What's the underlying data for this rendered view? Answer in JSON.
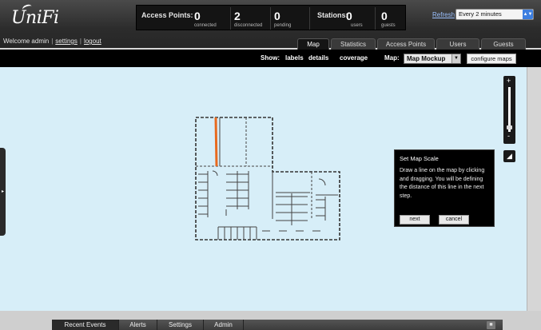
{
  "header": {
    "logo": "UniFi",
    "welcome_text": "Welcome admin",
    "settings_link": "settings",
    "logout_link": "logout"
  },
  "stats": {
    "access_points_label": "Access Points:",
    "stations_label": "Stations:",
    "items": [
      {
        "value": "0",
        "label": "connected"
      },
      {
        "value": "2",
        "label": "disconnected"
      },
      {
        "value": "0",
        "label": "pending"
      },
      {
        "value": "0",
        "label": "users"
      },
      {
        "value": "0",
        "label": "guests"
      }
    ]
  },
  "refresh": {
    "link": "Refresh",
    "selected": "Every 2 minutes"
  },
  "tabs": [
    "Map",
    "Statistics",
    "Access Points",
    "Users",
    "Guests"
  ],
  "toolbar": {
    "show_label": "Show:",
    "labels": "labels",
    "details": "details",
    "coverage": "coverage",
    "map_label": "Map:",
    "map_selected": "Map Mockup",
    "configure_button": "configure maps"
  },
  "dialog": {
    "title": "Set Map Scale",
    "body": "Draw a line on the map by clicking and dragging. You will be defining the distance of this line in the next step.",
    "next": "next",
    "cancel": "cancel"
  },
  "bottom_tabs": [
    "Recent Events",
    "Alerts",
    "Settings",
    "Admin"
  ],
  "colors": {
    "map_background": "#d7eef8",
    "scale_line": "#e86a1f",
    "header": "#2c2c2c"
  }
}
